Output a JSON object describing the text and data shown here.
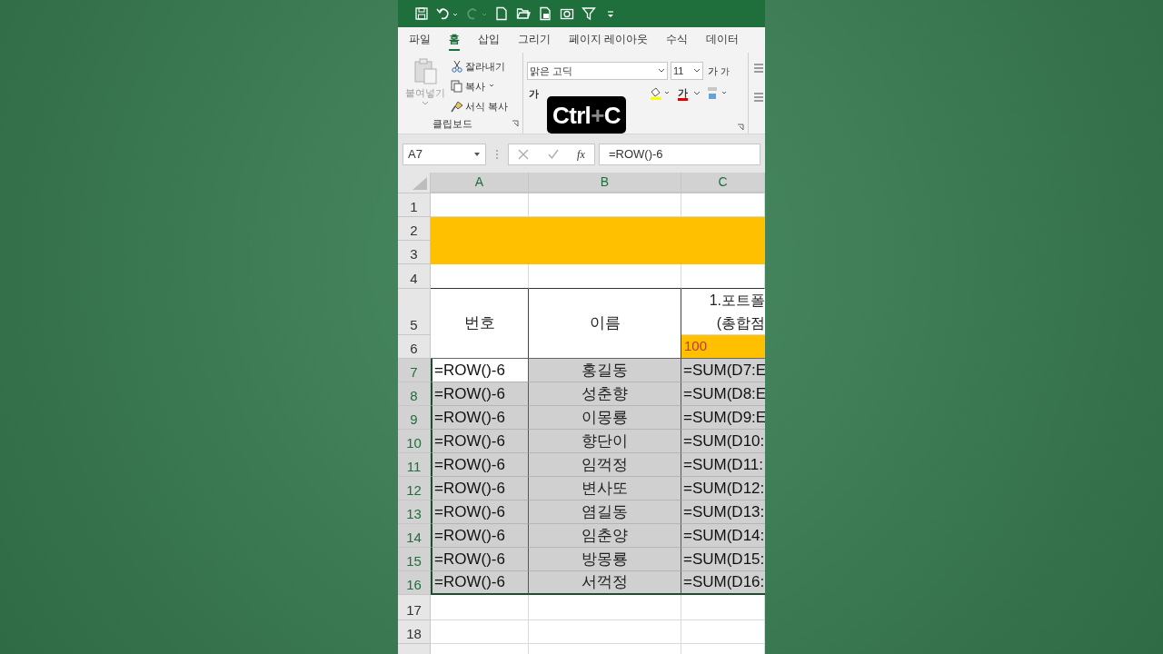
{
  "quick_access": [
    {
      "kind": "save",
      "disabled": false
    },
    {
      "kind": "undo",
      "disabled": false
    },
    {
      "kind": "redo",
      "disabled": true
    },
    {
      "kind": "new",
      "disabled": false
    },
    {
      "kind": "open",
      "disabled": false
    },
    {
      "kind": "preview",
      "disabled": false
    },
    {
      "kind": "camera",
      "disabled": false
    },
    {
      "kind": "filter",
      "disabled": false
    },
    {
      "kind": "customize",
      "disabled": false
    }
  ],
  "tabs": [
    {
      "label": "파일",
      "selected": false
    },
    {
      "label": "홈",
      "selected": true
    },
    {
      "label": "삽입",
      "selected": false
    },
    {
      "label": "그리기",
      "selected": false
    },
    {
      "label": "페이지 레이아웃",
      "selected": false
    },
    {
      "label": "수식",
      "selected": false
    },
    {
      "label": "데이터",
      "selected": false
    }
  ],
  "clipboard": {
    "paste": {
      "label": "붙여넣기",
      "disabled": true
    },
    "cut": "잘라내기",
    "copy": "복사",
    "format_painter": "서식 복사",
    "group_label": "클립보드"
  },
  "font": {
    "name": "맑은 고딕",
    "size": "11",
    "grow": "가",
    "shrink": "가",
    "bold": "가",
    "font_color": "가"
  },
  "overlay": {
    "keys": [
      "Ctrl",
      "C"
    ],
    "separator": "+"
  },
  "formula_bar": {
    "name_box": "A7",
    "fx": "fx",
    "formula": "=ROW()-6"
  },
  "columns": [
    {
      "label": "A",
      "selected": true
    },
    {
      "label": "B",
      "selected": true
    },
    {
      "label": "C",
      "selected": true
    }
  ],
  "row_headers": [
    {
      "label": "1",
      "selected": false
    },
    {
      "label": "2",
      "selected": false
    },
    {
      "label": "3",
      "selected": false
    },
    {
      "label": "4",
      "selected": false
    },
    {
      "label": "5",
      "selected": false
    },
    {
      "label": "6",
      "selected": false
    },
    {
      "label": "7",
      "selected": true
    },
    {
      "label": "8",
      "selected": true
    },
    {
      "label": "9",
      "selected": true
    },
    {
      "label": "10",
      "selected": true
    },
    {
      "label": "11",
      "selected": true
    },
    {
      "label": "12",
      "selected": true
    },
    {
      "label": "13",
      "selected": true
    },
    {
      "label": "14",
      "selected": true
    },
    {
      "label": "15",
      "selected": true
    },
    {
      "label": "16",
      "selected": true
    },
    {
      "label": "17",
      "selected": false
    },
    {
      "label": "18",
      "selected": false
    }
  ],
  "table_header": {
    "number": "번호",
    "name": "이름",
    "column_c": [
      "1.포트폴",
      "(총합점"
    ],
    "column_c_value": "100"
  },
  "data_rows": [
    {
      "a": "=ROW()-6",
      "b": "홍길동",
      "c": "=SUM(D7:E",
      "active": true
    },
    {
      "a": "=ROW()-6",
      "b": "성춘향",
      "c": "=SUM(D8:E",
      "active": false
    },
    {
      "a": "=ROW()-6",
      "b": "이몽룡",
      "c": "=SUM(D9:E",
      "active": false
    },
    {
      "a": "=ROW()-6",
      "b": "향단이",
      "c": "=SUM(D10:",
      "active": false
    },
    {
      "a": "=ROW()-6",
      "b": "임꺽정",
      "c": "=SUM(D11:",
      "active": false
    },
    {
      "a": "=ROW()-6",
      "b": "변사또",
      "c": "=SUM(D12:",
      "active": false
    },
    {
      "a": "=ROW()-6",
      "b": "염길동",
      "c": "=SUM(D13:",
      "active": false
    },
    {
      "a": "=ROW()-6",
      "b": "임춘양",
      "c": "=SUM(D14:",
      "active": false
    },
    {
      "a": "=ROW()-6",
      "b": "방몽룡",
      "c": "=SUM(D15:",
      "active": false
    },
    {
      "a": "=ROW()-6",
      "b": "서꺽정",
      "c": "=SUM(D16:",
      "active": false
    }
  ]
}
